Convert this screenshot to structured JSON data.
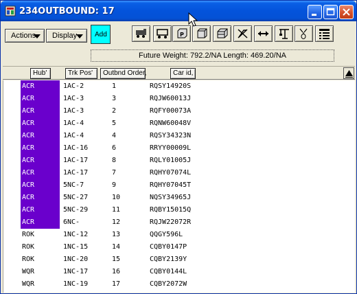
{
  "window": {
    "title": "234OUTBOUND: 17"
  },
  "toolbar": {
    "actions_label": "Actions",
    "display_label": "Display",
    "add_label": "Add",
    "icons": [
      "railcar-engine-icon",
      "flatcar-icon",
      "plate-icon",
      "cube-icon",
      "container-icon",
      "no-entry-icon",
      "horizontal-arrows-icon",
      "crane-icon",
      "weight-icon",
      "grid-list-icon"
    ]
  },
  "status": {
    "text": "Future Weight: 792.2/NA  Length: 469.20/NA"
  },
  "columns": {
    "hub": "Hub'",
    "trk_pos": "Trk Pos'",
    "outbnd_order": "Outbnd Order,",
    "car_id": "Car id,"
  },
  "rows": [
    {
      "hub": "ACR",
      "trk": "1AC-2",
      "ord": "1",
      "car": "RQSY14920S",
      "selected": true
    },
    {
      "hub": "ACR",
      "trk": "1AC-3",
      "ord": "3",
      "car": "RQJW60013J",
      "selected": true
    },
    {
      "hub": "ACR",
      "trk": "1AC-3",
      "ord": "2",
      "car": "RQFY00073A",
      "selected": true
    },
    {
      "hub": "ACR",
      "trk": "1AC-4",
      "ord": "5",
      "car": "RQNW60048V",
      "selected": true
    },
    {
      "hub": "ACR",
      "trk": "1AC-4",
      "ord": "4",
      "car": "RQSY34323N",
      "selected": true
    },
    {
      "hub": "ACR",
      "trk": "1AC-16",
      "ord": "6",
      "car": "RRYY00009L",
      "selected": true
    },
    {
      "hub": "ACR",
      "trk": "1AC-17",
      "ord": "8",
      "car": "RQLY01005J",
      "selected": true
    },
    {
      "hub": "ACR",
      "trk": "1AC-17",
      "ord": "7",
      "car": "RQHY07074L",
      "selected": true
    },
    {
      "hub": "ACR",
      "trk": "5NC-7",
      "ord": "9",
      "car": "RQHY07045T",
      "selected": true
    },
    {
      "hub": "ACR",
      "trk": "5NC-27",
      "ord": "10",
      "car": "NQSY34965J",
      "selected": true
    },
    {
      "hub": "ACR",
      "trk": "5NC-29",
      "ord": "11",
      "car": "RQBY15015Q",
      "selected": true
    },
    {
      "hub": "ACR",
      "trk": "6NC-",
      "ord": "12",
      "car": "RQJW22072R",
      "selected": true
    },
    {
      "hub": "ROK",
      "trk": "1NC-12",
      "ord": "13",
      "car": "QQGY596L",
      "selected": false
    },
    {
      "hub": "ROK",
      "trk": "1NC-15",
      "ord": "14",
      "car": "CQBY0147P",
      "selected": false
    },
    {
      "hub": "ROK",
      "trk": "1NC-20",
      "ord": "15",
      "car": "CQBY2139Y",
      "selected": false
    },
    {
      "hub": "WQR",
      "trk": "1NC-17",
      "ord": "16",
      "car": "CQBY0144L",
      "selected": false
    },
    {
      "hub": "WQR",
      "trk": "1NC-19",
      "ord": "17",
      "car": "CQBY2072W",
      "selected": false
    }
  ],
  "colors": {
    "selection": "#6a00cc",
    "add_button": "#00ffff",
    "titlebar": "#0453db"
  }
}
